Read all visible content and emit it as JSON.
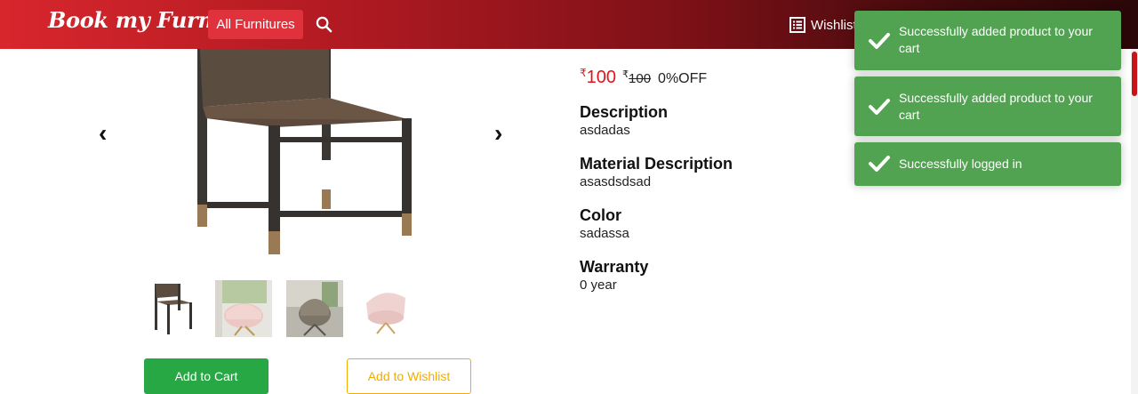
{
  "header": {
    "brand": "Book my Furniture",
    "category_button": "All Furnitures",
    "wishlist_label": "Wishlist",
    "search_icon": "search-icon",
    "wishlist_icon": "list-icon"
  },
  "gallery": {
    "prev_icon": "chevron-left-icon",
    "next_icon": "chevron-right-icon",
    "thumbnail_count": 4
  },
  "actions": {
    "add_to_cart": "Add to Cart",
    "add_to_wishlist": "Add to Wishlist"
  },
  "price": {
    "currency": "₹",
    "current": "100",
    "original": "100",
    "discount": "0%OFF"
  },
  "specs": [
    {
      "label": "Description",
      "value": "asdadas"
    },
    {
      "label": "Material Description",
      "value": "asasdsdsad"
    },
    {
      "label": "Color",
      "value": "sadassa"
    },
    {
      "label": "Warranty",
      "value": "0 year"
    }
  ],
  "toasts": [
    {
      "message": "Successfully added product to your cart"
    },
    {
      "message": "Successfully added product to your cart"
    },
    {
      "message": "Successfully logged in"
    }
  ],
  "colors": {
    "brand_red": "#d8262d",
    "success_green": "#28a745",
    "toast_green": "#51a351",
    "warning_yellow": "#f0ad00",
    "price_red": "#e2141b"
  }
}
